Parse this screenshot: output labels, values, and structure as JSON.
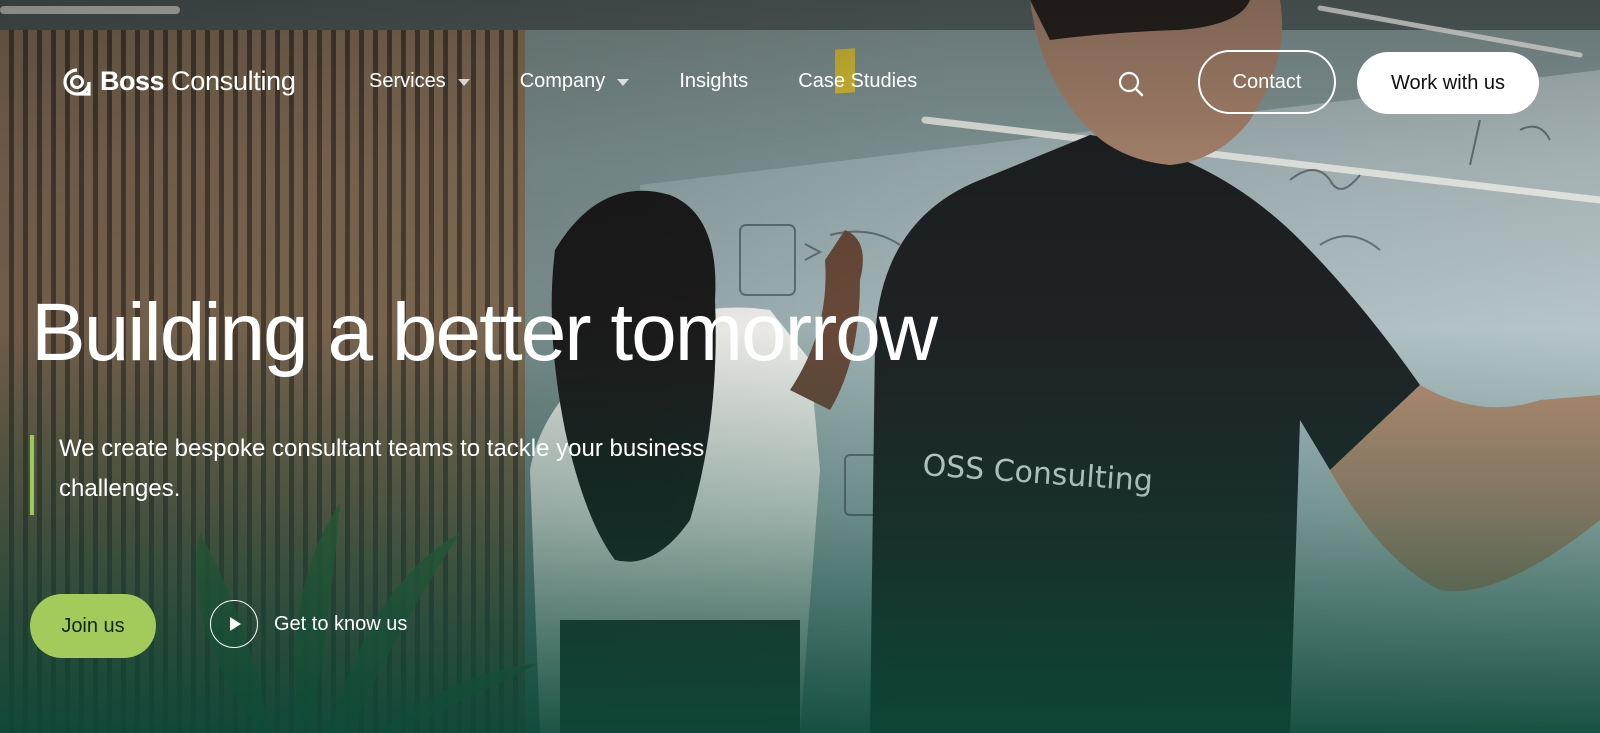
{
  "brand": {
    "name_bold": "Boss",
    "name_light": "Consulting",
    "icon": "boss-logo-mark-icon"
  },
  "nav": {
    "items": [
      {
        "label": "Services",
        "has_dropdown": true
      },
      {
        "label": "Company",
        "has_dropdown": true
      },
      {
        "label": "Insights",
        "has_dropdown": false
      },
      {
        "label": "Case Studies",
        "has_dropdown": false
      }
    ],
    "search_icon": "search-icon",
    "contact_label": "Contact",
    "work_label": "Work with us"
  },
  "hero": {
    "headline": "Building a better tomorrow",
    "subheading": "We create bespoke consultant teams to tackle your business challenges.",
    "primary_cta": "Join us",
    "secondary_cta": "Get to know us",
    "secondary_icon": "play-icon",
    "background": "office-whiteboard-photo",
    "shirt_print": "OSS Consulting"
  },
  "colors": {
    "accent_green": "#a3cb5b",
    "bottom_gradient": "#0b4838",
    "text": "#ffffff"
  }
}
